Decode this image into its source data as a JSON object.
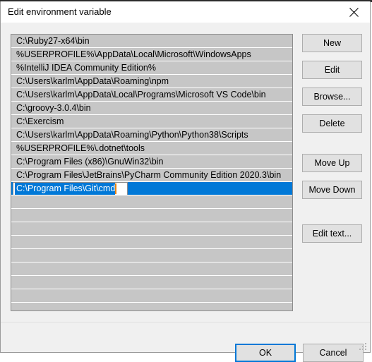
{
  "window": {
    "title": "Edit environment variable",
    "close_icon": "close-icon"
  },
  "list": {
    "items": [
      "C:\\Ruby27-x64\\bin",
      "%USERPROFILE%\\AppData\\Local\\Microsoft\\WindowsApps",
      "%IntelliJ IDEA Community Edition%",
      "C:\\Users\\karlm\\AppData\\Roaming\\npm",
      "C:\\Users\\karlm\\AppData\\Local\\Programs\\Microsoft VS Code\\bin",
      "C:\\groovy-3.0.4\\bin",
      "C:\\Exercism",
      "C:\\Users\\karlm\\AppData\\Roaming\\Python\\Python38\\Scripts",
      "%USERPROFILE%\\.dotnet\\tools",
      "C:\\Program Files (x86)\\GnuWin32\\bin",
      "C:\\Program Files\\JetBrains\\PyCharm Community Edition 2020.3\\bin"
    ],
    "selected_index": 11,
    "editing_value": "C:\\Program Files\\Git\\cmd",
    "empty_row_count": 9,
    "selection_color": "#0078d7",
    "caret_color": "#e8820c"
  },
  "side_buttons": [
    {
      "label": "New",
      "name": "new-button"
    },
    {
      "label": "Edit",
      "name": "edit-button"
    },
    {
      "label": "Browse...",
      "name": "browse-button"
    },
    {
      "label": "Delete",
      "name": "delete-button"
    },
    {
      "label": "Move Up",
      "name": "move-up-button"
    },
    {
      "label": "Move Down",
      "name": "move-down-button"
    },
    {
      "label": "Edit text...",
      "name": "edit-text-button"
    }
  ],
  "footer": {
    "ok_label": "OK",
    "cancel_label": "Cancel",
    "focus_color": "#0078d7"
  }
}
